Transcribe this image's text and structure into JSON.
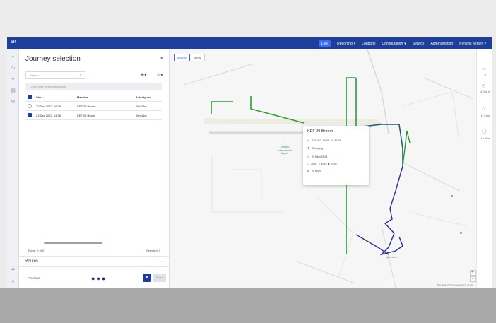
{
  "navbar": {
    "logo": "elt",
    "items": [
      {
        "label": "Live",
        "active": true
      },
      {
        "label": "Reporting",
        "chevron": true
      },
      {
        "label": "Logbook",
        "chevron": false
      },
      {
        "label": "Configuration",
        "chevron": true
      },
      {
        "label": "Service",
        "chevron": false
      },
      {
        "label": "Administration",
        "chevron": false
      },
      {
        "label": "Keflavik Airport",
        "chevron": true
      }
    ],
    "chevron_glyph": "▾",
    "colors": {
      "bar": "#1e3e9a",
      "active": "#3a6ce8"
    }
  },
  "panel": {
    "title": "Journey selection",
    "close": "×",
    "search_placeholder": "Search",
    "group_hint": "Drag here to set row groups",
    "filter_icon": "⚑▾",
    "settings_icon": "⚙▾",
    "columns": [
      "Start ↓",
      "Machine",
      "Activity dur."
    ],
    "rows": [
      {
        "start": "23 Dec 2022, 09:38",
        "machine": "KEF 29 Broom",
        "activity": "09h 27m",
        "selected": false
      },
      {
        "start": "23 Dec 2022, 14:38",
        "machine": "KEF 29 Broom",
        "activity": "00h 41m",
        "selected": true
      }
    ],
    "rows_count": "Rows: 2 of 2",
    "selected_count": "Selected: 1",
    "routes_label": "Routes",
    "routes_chevron": "⌄",
    "previous": "Previous",
    "dots": "●●●",
    "close_button": "✕",
    "next": "Show"
  },
  "map": {
    "tabs": [
      {
        "label": "Activity",
        "active": true
      },
      {
        "label": "Verify",
        "active": false
      }
    ],
    "airport_label": "Keflavik International Airport",
    "place_labels": [
      "Njardvikur"
    ],
    "attribution": "Map data ©2023 Google  Terms of Use",
    "zoom_in": "+",
    "zoom_out": "−",
    "popup": {
      "title": "KEF 29 Broom",
      "time": "23/12/22, 14:38 - 15:20:15",
      "status": "Sweeping",
      "distance": "20.5 km    15.93",
      "speeds": "20.5 ↑   ●  40.5 ↑   ▶  20.5 ↑",
      "extra": "20 km/h"
    },
    "colors": {
      "green_route": "#2e9a3c",
      "blue_route": "#2c2f8c",
      "runway": "#e2e2e2",
      "teal_route": "#1f5f6a"
    }
  },
  "right_stats": [
    {
      "icon": "▭",
      "value": "0"
    },
    {
      "icon": "◷",
      "value": "41:54 hh"
    },
    {
      "icon": "△",
      "value": "17.6 km"
    },
    {
      "icon": "◯",
      "value": "13.8 km"
    }
  ],
  "rail_icons": [
    "search-icon",
    "route-icon",
    "pin-icon",
    "layers-icon",
    "settings-icon"
  ]
}
